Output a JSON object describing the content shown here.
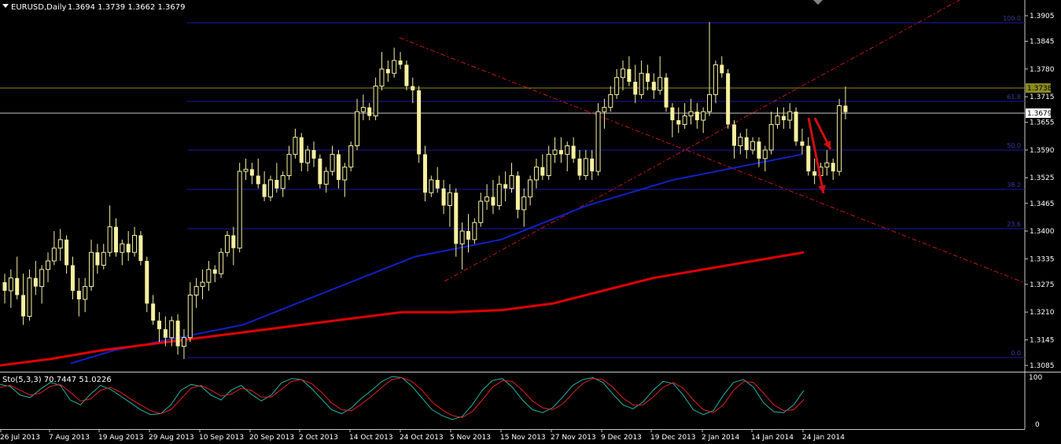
{
  "header": {
    "symbol": "EURUSD,Daily",
    "ohlc": "1.3694 1.3739 1.3662 1.3679"
  },
  "indicator": {
    "label": "Sto(5,3,3) 70.7447 51.0226",
    "scale_labels": [
      "100",
      "0"
    ]
  },
  "colors": {
    "background": "#000000",
    "candle": "#f7f0a0",
    "ma_fast": "#1020c8",
    "ma_slow": "#e00000",
    "fib_line": "#1a1aa8",
    "trend_line": "#c01818",
    "stoch_main": "#22b3a8",
    "stoch_signal": "#e02020",
    "axis": "#c8c8c8"
  },
  "chart_data": {
    "type": "candlestick",
    "symbol": "EURUSD",
    "timeframe": "Daily",
    "price_axis": {
      "labels": [
        "1.3905",
        "1.3845",
        "1.3780",
        "1.3715",
        "1.3655",
        "1.3590",
        "1.3525",
        "1.3465",
        "1.3400",
        "1.3335",
        "1.3275",
        "1.3210",
        "1.3145",
        "1.3085"
      ],
      "range": [
        1.3075,
        1.3925
      ]
    },
    "price_tags": {
      "current": "1.3679",
      "high_line": "1.3738"
    },
    "date_labels": [
      "26 Jul 2013",
      "7 Aug 2013",
      "19 Aug 2013",
      "29 Aug 2013",
      "10 Sep 2013",
      "20 Sep 2013",
      "2 Oct 2013",
      "14 Oct 2013",
      "24 Oct 2013",
      "5 Nov 2013",
      "15 Nov 2013",
      "27 Nov 2013",
      "9 Dec 2013",
      "19 Dec 2013",
      "2 Jan 2014",
      "14 Jan 2014",
      "24 Jan 2014"
    ],
    "candles": [
      [
        1.328,
        1.33,
        1.323,
        1.326
      ],
      [
        1.326,
        1.331,
        1.322,
        1.329
      ],
      [
        1.329,
        1.334,
        1.324,
        1.325
      ],
      [
        1.325,
        1.33,
        1.318,
        1.32
      ],
      [
        1.32,
        1.331,
        1.319,
        1.329
      ],
      [
        1.329,
        1.333,
        1.325,
        1.327
      ],
      [
        1.327,
        1.332,
        1.323,
        1.331
      ],
      [
        1.331,
        1.335,
        1.328,
        1.333
      ],
      [
        1.333,
        1.34,
        1.332,
        1.336
      ],
      [
        1.336,
        1.3405,
        1.333,
        1.338
      ],
      [
        1.338,
        1.339,
        1.33,
        1.332
      ],
      [
        1.332,
        1.334,
        1.324,
        1.326
      ],
      [
        1.326,
        1.329,
        1.32,
        1.324
      ],
      [
        1.324,
        1.329,
        1.321,
        1.327
      ],
      [
        1.327,
        1.338,
        1.326,
        1.335
      ],
      [
        1.335,
        1.337,
        1.33,
        1.332
      ],
      [
        1.332,
        1.337,
        1.331,
        1.335
      ],
      [
        1.335,
        1.346,
        1.334,
        1.341
      ],
      [
        1.341,
        1.343,
        1.334,
        1.335
      ],
      [
        1.335,
        1.338,
        1.332,
        1.337
      ],
      [
        1.337,
        1.34,
        1.333,
        1.335
      ],
      [
        1.335,
        1.341,
        1.334,
        1.339
      ],
      [
        1.339,
        1.34,
        1.332,
        1.333
      ],
      [
        1.333,
        1.334,
        1.321,
        1.323
      ],
      [
        1.323,
        1.325,
        1.318,
        1.319
      ],
      [
        1.319,
        1.321,
        1.314,
        1.317
      ],
      [
        1.317,
        1.32,
        1.313,
        1.315
      ],
      [
        1.315,
        1.32,
        1.313,
        1.319
      ],
      [
        1.319,
        1.3205,
        1.311,
        1.313
      ],
      [
        1.313,
        1.317,
        1.31,
        1.315
      ],
      [
        1.315,
        1.328,
        1.314,
        1.325
      ],
      [
        1.325,
        1.329,
        1.322,
        1.327
      ],
      [
        1.327,
        1.331,
        1.324,
        1.328
      ],
      [
        1.328,
        1.333,
        1.326,
        1.331
      ],
      [
        1.331,
        1.332,
        1.328,
        1.33
      ],
      [
        1.33,
        1.336,
        1.329,
        1.335
      ],
      [
        1.335,
        1.34,
        1.334,
        1.339
      ],
      [
        1.339,
        1.341,
        1.332,
        1.336
      ],
      [
        1.336,
        1.356,
        1.335,
        1.354
      ],
      [
        1.354,
        1.357,
        1.352,
        1.3545
      ],
      [
        1.3545,
        1.356,
        1.351,
        1.353
      ],
      [
        1.353,
        1.357,
        1.35,
        1.351
      ],
      [
        1.351,
        1.354,
        1.347,
        1.348
      ],
      [
        1.348,
        1.353,
        1.347,
        1.352
      ],
      [
        1.352,
        1.356,
        1.349,
        1.35
      ],
      [
        1.35,
        1.354,
        1.348,
        1.353
      ],
      [
        1.353,
        1.36,
        1.352,
        1.358
      ],
      [
        1.358,
        1.364,
        1.357,
        1.362
      ],
      [
        1.362,
        1.363,
        1.354,
        1.356
      ],
      [
        1.356,
        1.36,
        1.354,
        1.359
      ],
      [
        1.359,
        1.361,
        1.355,
        1.357
      ],
      [
        1.357,
        1.358,
        1.35,
        1.351
      ],
      [
        1.351,
        1.355,
        1.349,
        1.354
      ],
      [
        1.354,
        1.36,
        1.353,
        1.358
      ],
      [
        1.358,
        1.359,
        1.35,
        1.352
      ],
      [
        1.352,
        1.356,
        1.348,
        1.355
      ],
      [
        1.355,
        1.361,
        1.354,
        1.36
      ],
      [
        1.36,
        1.371,
        1.359,
        1.368
      ],
      [
        1.368,
        1.372,
        1.366,
        1.369
      ],
      [
        1.369,
        1.37,
        1.366,
        1.367
      ],
      [
        1.367,
        1.376,
        1.366,
        1.374
      ],
      [
        1.374,
        1.382,
        1.373,
        1.378
      ],
      [
        1.378,
        1.38,
        1.375,
        1.377
      ],
      [
        1.377,
        1.383,
        1.376,
        1.38
      ],
      [
        1.38,
        1.382,
        1.378,
        1.379
      ],
      [
        1.379,
        1.38,
        1.373,
        1.374
      ],
      [
        1.374,
        1.376,
        1.37,
        1.373
      ],
      [
        1.373,
        1.374,
        1.356,
        1.358
      ],
      [
        1.358,
        1.36,
        1.347,
        1.349
      ],
      [
        1.349,
        1.353,
        1.348,
        1.352
      ],
      [
        1.352,
        1.355,
        1.349,
        1.35
      ],
      [
        1.35,
        1.352,
        1.344,
        1.346
      ],
      [
        1.346,
        1.351,
        1.341,
        1.349
      ],
      [
        1.349,
        1.35,
        1.334,
        1.337
      ],
      [
        1.337,
        1.342,
        1.331,
        1.34
      ],
      [
        1.34,
        1.344,
        1.335,
        1.338
      ],
      [
        1.338,
        1.343,
        1.337,
        1.342
      ],
      [
        1.342,
        1.349,
        1.341,
        1.347
      ],
      [
        1.347,
        1.351,
        1.345,
        1.348
      ],
      [
        1.348,
        1.352,
        1.344,
        1.346
      ],
      [
        1.346,
        1.353,
        1.345,
        1.351
      ],
      [
        1.351,
        1.354,
        1.347,
        1.35
      ],
      [
        1.35,
        1.356,
        1.349,
        1.353
      ],
      [
        1.353,
        1.354,
        1.343,
        1.345
      ],
      [
        1.345,
        1.35,
        1.341,
        1.348
      ],
      [
        1.348,
        1.353,
        1.346,
        1.352
      ],
      [
        1.352,
        1.357,
        1.35,
        1.355
      ],
      [
        1.355,
        1.358,
        1.352,
        1.353
      ],
      [
        1.353,
        1.36,
        1.352,
        1.358
      ],
      [
        1.358,
        1.362,
        1.356,
        1.359
      ],
      [
        1.359,
        1.362,
        1.356,
        1.358
      ],
      [
        1.358,
        1.361,
        1.354,
        1.36
      ],
      [
        1.36,
        1.362,
        1.356,
        1.357
      ],
      [
        1.357,
        1.359,
        1.352,
        1.353
      ],
      [
        1.353,
        1.359,
        1.352,
        1.357
      ],
      [
        1.357,
        1.359,
        1.352,
        1.354
      ],
      [
        1.354,
        1.37,
        1.353,
        1.368
      ],
      [
        1.368,
        1.371,
        1.364,
        1.369
      ],
      [
        1.369,
        1.374,
        1.368,
        1.372
      ],
      [
        1.372,
        1.378,
        1.371,
        1.376
      ],
      [
        1.376,
        1.38,
        1.373,
        1.378
      ],
      [
        1.378,
        1.381,
        1.374,
        1.375
      ],
      [
        1.375,
        1.379,
        1.37,
        1.372
      ],
      [
        1.372,
        1.38,
        1.371,
        1.377
      ],
      [
        1.377,
        1.379,
        1.373,
        1.375
      ],
      [
        1.375,
        1.377,
        1.371,
        1.373
      ],
      [
        1.373,
        1.381,
        1.372,
        1.376
      ],
      [
        1.376,
        1.377,
        1.368,
        1.369
      ],
      [
        1.369,
        1.37,
        1.362,
        1.366
      ],
      [
        1.366,
        1.369,
        1.363,
        1.365
      ],
      [
        1.365,
        1.37,
        1.364,
        1.367
      ],
      [
        1.367,
        1.371,
        1.365,
        1.368
      ],
      [
        1.368,
        1.37,
        1.364,
        1.366
      ],
      [
        1.366,
        1.369,
        1.363,
        1.368
      ],
      [
        1.368,
        1.389,
        1.367,
        1.372
      ],
      [
        1.372,
        1.38,
        1.37,
        1.379
      ],
      [
        1.379,
        1.381,
        1.376,
        1.377
      ],
      [
        1.377,
        1.378,
        1.364,
        1.365
      ],
      [
        1.365,
        1.366,
        1.357,
        1.36
      ],
      [
        1.36,
        1.363,
        1.358,
        1.362
      ],
      [
        1.362,
        1.364,
        1.357,
        1.359
      ],
      [
        1.359,
        1.362,
        1.358,
        1.361
      ],
      [
        1.361,
        1.362,
        1.355,
        1.357
      ],
      [
        1.357,
        1.36,
        1.354,
        1.359
      ],
      [
        1.359,
        1.368,
        1.358,
        1.365
      ],
      [
        1.365,
        1.369,
        1.364,
        1.367
      ],
      [
        1.367,
        1.369,
        1.364,
        1.366
      ],
      [
        1.366,
        1.37,
        1.364,
        1.368
      ],
      [
        1.368,
        1.369,
        1.36,
        1.361
      ],
      [
        1.361,
        1.364,
        1.358,
        1.36
      ],
      [
        1.36,
        1.362,
        1.353,
        1.354
      ],
      [
        1.354,
        1.357,
        1.351,
        1.353
      ],
      [
        1.353,
        1.356,
        1.351,
        1.355
      ],
      [
        1.355,
        1.359,
        1.353,
        1.356
      ],
      [
        1.356,
        1.357,
        1.352,
        1.354
      ],
      [
        1.354,
        1.371,
        1.353,
        1.3694
      ],
      [
        1.3694,
        1.3739,
        1.3662,
        1.3679
      ]
    ],
    "sma_fast": [
      1.309,
      1.312,
      1.314,
      1.316,
      1.318,
      1.322,
      1.326,
      1.33,
      1.334,
      1.336,
      1.338,
      1.342,
      1.346,
      1.349,
      1.352,
      1.354,
      1.356,
      1.358
    ],
    "sma_slow": [
      1.3085,
      1.31,
      1.312,
      1.3135,
      1.315,
      1.3165,
      1.318,
      1.3195,
      1.321,
      1.321,
      1.3215,
      1.323,
      1.326,
      1.329,
      1.331,
      1.333,
      1.335
    ],
    "fib_levels": [
      "100.0",
      "61.8",
      "50.0",
      "38.2",
      "23.6",
      "0.0"
    ],
    "stochastic": {
      "k_value": 70.7447,
      "d_value": 51.0226,
      "k": [
        82,
        78,
        60,
        55,
        72,
        86,
        80,
        50,
        40,
        62,
        80,
        72,
        58,
        44,
        30,
        20,
        22,
        40,
        70,
        82,
        78,
        60,
        50,
        70,
        80,
        62,
        48,
        60,
        85,
        94,
        92,
        74,
        52,
        30,
        22,
        34,
        54,
        70,
        88,
        98,
        96,
        78,
        54,
        30,
        18,
        10,
        16,
        40,
        70,
        90,
        94,
        76,
        50,
        30,
        24,
        34,
        56,
        80,
        92,
        96,
        86,
        62,
        40,
        32,
        46,
        70,
        88,
        84,
        60,
        30,
        20,
        28,
        60,
        86,
        92,
        76,
        44,
        26,
        24,
        40,
        70
      ],
      "d": [
        76,
        80,
        70,
        60,
        64,
        78,
        82,
        66,
        48,
        52,
        70,
        76,
        66,
        52,
        40,
        28,
        22,
        30,
        52,
        74,
        80,
        70,
        58,
        62,
        74,
        70,
        56,
        56,
        72,
        88,
        92,
        84,
        66,
        44,
        30,
        28,
        42,
        58,
        76,
        92,
        96,
        88,
        70,
        46,
        30,
        18,
        14,
        26,
        50,
        76,
        90,
        88,
        70,
        48,
        34,
        30,
        42,
        64,
        84,
        94,
        92,
        76,
        54,
        40,
        40,
        56,
        76,
        86,
        74,
        50,
        30,
        24,
        40,
        70,
        88,
        86,
        64,
        40,
        28,
        30,
        51
      ]
    }
  }
}
